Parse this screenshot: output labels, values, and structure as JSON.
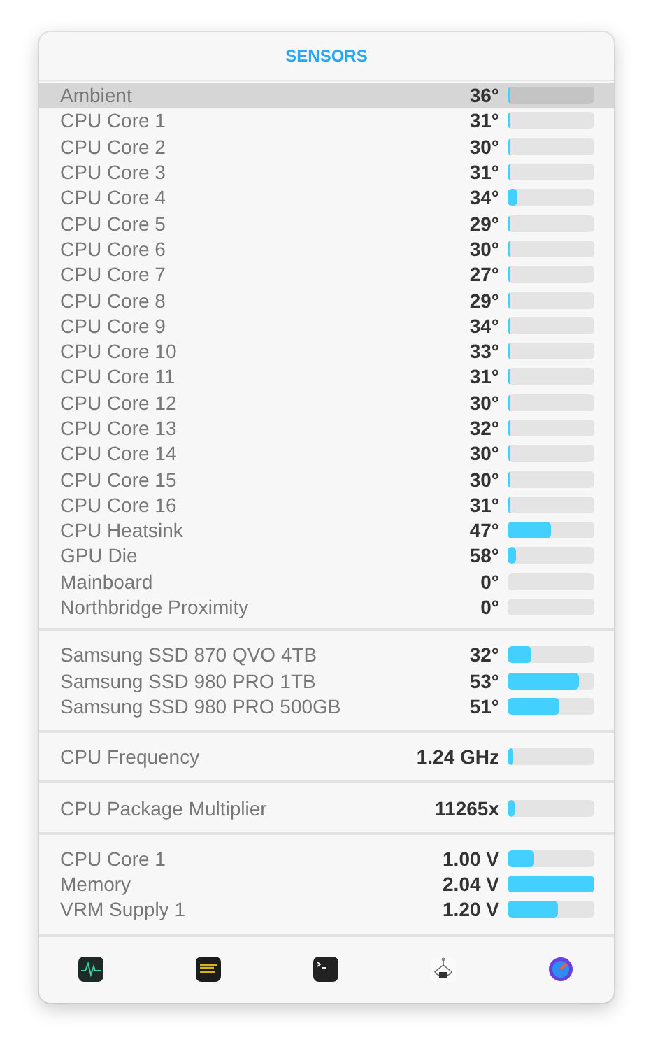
{
  "title": "SENSORS",
  "sections": [
    {
      "rows": [
        {
          "name": "Ambient",
          "value": "36°",
          "level": 0.02,
          "selected": true
        },
        {
          "name": "CPU Core 1",
          "value": "31°",
          "level": 0.03,
          "selected": false
        },
        {
          "name": "CPU Core 2",
          "value": "30°",
          "level": 0.03,
          "selected": false
        },
        {
          "name": "CPU Core 3",
          "value": "31°",
          "level": 0.03,
          "selected": false
        },
        {
          "name": "CPU Core 4",
          "value": "34°",
          "level": 0.12,
          "selected": false
        },
        {
          "name": "CPU Core 5",
          "value": "29°",
          "level": 0.02,
          "selected": false
        },
        {
          "name": "CPU Core 6",
          "value": "30°",
          "level": 0.03,
          "selected": false
        },
        {
          "name": "CPU Core 7",
          "value": "27°",
          "level": 0.02,
          "selected": false
        },
        {
          "name": "CPU Core 8",
          "value": "29°",
          "level": 0.03,
          "selected": false
        },
        {
          "name": "CPU Core 9",
          "value": "34°",
          "level": 0.03,
          "selected": false
        },
        {
          "name": "CPU Core 10",
          "value": "33°",
          "level": 0.03,
          "selected": false
        },
        {
          "name": "CPU Core 11",
          "value": "31°",
          "level": 0.03,
          "selected": false
        },
        {
          "name": "CPU Core 12",
          "value": "30°",
          "level": 0.03,
          "selected": false
        },
        {
          "name": "CPU Core 13",
          "value": "32°",
          "level": 0.03,
          "selected": false
        },
        {
          "name": "CPU Core 14",
          "value": "30°",
          "level": 0.04,
          "selected": false
        },
        {
          "name": "CPU Core 15",
          "value": "30°",
          "level": 0.03,
          "selected": false
        },
        {
          "name": "CPU Core 16",
          "value": "31°",
          "level": 0.03,
          "selected": false
        },
        {
          "name": "CPU Heatsink",
          "value": "47°",
          "level": 0.5,
          "selected": false
        },
        {
          "name": "GPU Die",
          "value": "58°",
          "level": 0.09,
          "selected": false
        },
        {
          "name": "Mainboard",
          "value": "0°",
          "level": 0,
          "selected": false
        },
        {
          "name": "Northbridge Proximity",
          "value": "0°",
          "level": 0,
          "selected": false
        }
      ]
    },
    {
      "rows": [
        {
          "name": "Samsung SSD 870 QVO 4TB",
          "value": "32°",
          "level": 0.28,
          "selected": false
        },
        {
          "name": "Samsung SSD 980 PRO 1TB",
          "value": "53°",
          "level": 0.83,
          "selected": false
        },
        {
          "name": "Samsung SSD 980 PRO 500GB",
          "value": "51°",
          "level": 0.6,
          "selected": false
        }
      ]
    },
    {
      "rows": [
        {
          "name": "CPU Frequency",
          "value": "1.24 GHz",
          "level": 0.06,
          "selected": false
        }
      ]
    },
    {
      "rows": [
        {
          "name": "CPU Package Multiplier",
          "value": "11265x",
          "level": 0.08,
          "selected": false
        }
      ]
    },
    {
      "rows": [
        {
          "name": "CPU Core 1",
          "value": "1.00 V",
          "level": 0.3,
          "selected": false
        },
        {
          "name": "Memory",
          "value": "2.04 V",
          "level": 1,
          "selected": false
        },
        {
          "name": "VRM Supply 1",
          "value": "1.20 V",
          "level": 0.58,
          "selected": false
        }
      ]
    }
  ]
}
